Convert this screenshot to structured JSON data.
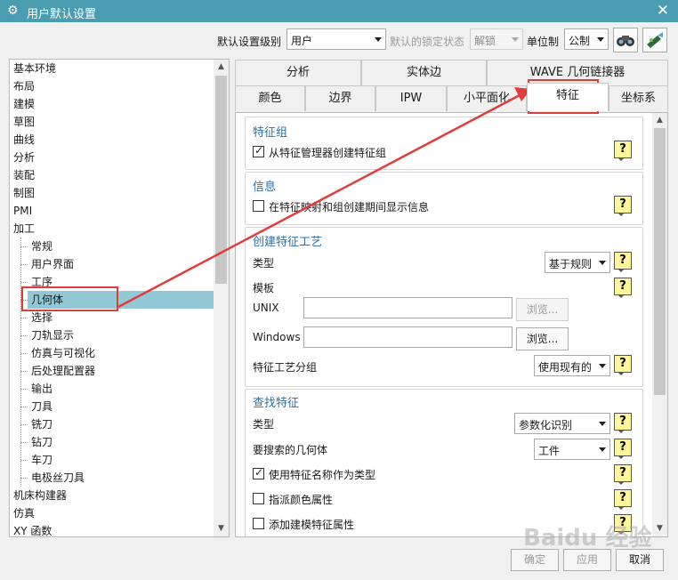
{
  "window": {
    "title": "用户默认设置"
  },
  "toolbar": {
    "level_label": "默认设置级别",
    "level_value": "用户",
    "lock_label": "默认的锁定状态",
    "lock_value": "解锁",
    "unit_label": "单位制",
    "unit_value": "公制"
  },
  "tree": {
    "items": [
      {
        "label": "基本环境"
      },
      {
        "label": "布局"
      },
      {
        "label": "建模"
      },
      {
        "label": "草图"
      },
      {
        "label": "曲线"
      },
      {
        "label": "分析"
      },
      {
        "label": "装配"
      },
      {
        "label": "制图"
      },
      {
        "label": "PMI"
      },
      {
        "label": "加工"
      },
      {
        "label": "常规"
      },
      {
        "label": "用户界面"
      },
      {
        "label": "工序"
      },
      {
        "label": "几何体"
      },
      {
        "label": "选择"
      },
      {
        "label": "刀轨显示"
      },
      {
        "label": "仿真与可视化"
      },
      {
        "label": "后处理配置器"
      },
      {
        "label": "输出"
      },
      {
        "label": "刀具"
      },
      {
        "label": "铣刀"
      },
      {
        "label": "钻刀"
      },
      {
        "label": "车刀"
      },
      {
        "label": "电极丝刀具"
      },
      {
        "label": "机床构建器"
      },
      {
        "label": "仿真"
      },
      {
        "label": "XY 函数"
      }
    ],
    "selected": "几何体"
  },
  "tabs": {
    "row1": [
      "分析",
      "实体边",
      "WAVE 几何链接器"
    ],
    "row2": [
      "颜色",
      "边界",
      "IPW",
      "小平面化",
      "特征",
      "坐标系"
    ],
    "active": "特征"
  },
  "sections": {
    "feature_group": {
      "title": "特征组",
      "create_from_manager": "从特征管理器创建特征组"
    },
    "info": {
      "title": "信息",
      "show_info": "在特征映射和组创建期间显示信息"
    },
    "create_process": {
      "title": "创建特征工艺",
      "type_label": "类型",
      "type_value": "基于规则",
      "template_label": "模板",
      "unix_label": "UNIX",
      "windows_label": "Windows",
      "browse_label": "浏览...",
      "group_label": "特征工艺分组",
      "group_value": "使用现有的"
    },
    "find_feature": {
      "title": "查找特征",
      "type_label": "类型",
      "type_value": "参数化识别",
      "geometry_label": "要搜索的几何体",
      "geometry_value": "工件",
      "use_name": "使用特征名称作为类型",
      "assign_color": "指派颜色属性",
      "add_modeling": "添加建模特征属性"
    }
  },
  "help_label": "?",
  "footer": {
    "ok_label": "确定",
    "apply_label": "应用",
    "cancel_label": "取消"
  },
  "watermark": "Baidu 经验",
  "icons": {
    "app": "gear-icon",
    "close": "close-icon",
    "tb1": "binoculars-icon",
    "tb2": "wand-icon"
  }
}
